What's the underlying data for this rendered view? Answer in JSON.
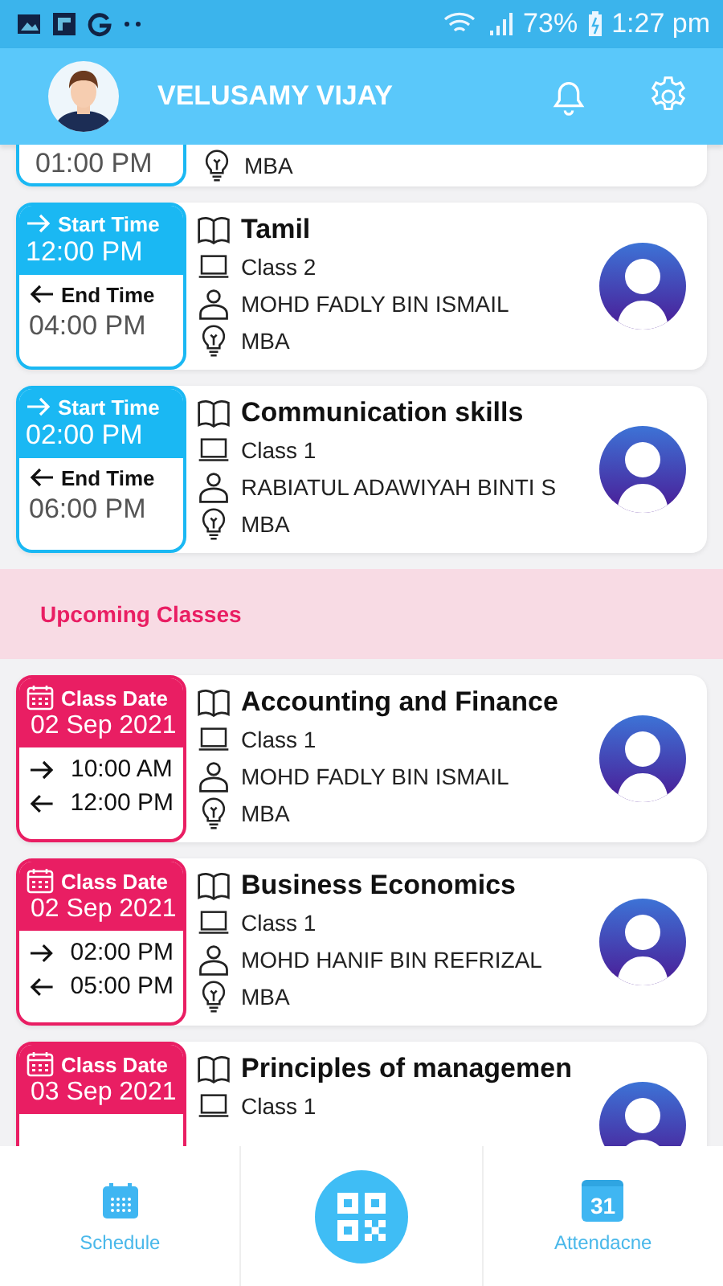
{
  "status_bar": {
    "battery": "73%",
    "time": "1:27 pm"
  },
  "header": {
    "name": "VELUSAMY VIJAY"
  },
  "today_classes": [
    {
      "kind": "partial",
      "end_time": "01:00 PM",
      "program": "MBA"
    },
    {
      "kind": "full",
      "start_label": "Start Time",
      "start_time": "12:00 PM",
      "end_label": "End Time",
      "end_time": "04:00 PM",
      "subject": "Tamil",
      "class": "Class 2",
      "teacher": "MOHD FADLY BIN ISMAIL",
      "program": "MBA"
    },
    {
      "kind": "full",
      "start_label": "Start Time",
      "start_time": "02:00 PM",
      "end_label": "End Time",
      "end_time": "06:00 PM",
      "subject": "Communication skills",
      "class": "Class 1",
      "teacher": "RABIATUL ADAWIYAH BINTI S",
      "program": "MBA"
    }
  ],
  "section_title": "Upcoming Classes",
  "upcoming_classes": [
    {
      "date_label": "Class Date",
      "date": "02 Sep 2021",
      "start_time": "10:00 AM",
      "end_time": "12:00 PM",
      "subject": "Accounting and Finance",
      "class": "Class 1",
      "teacher": "MOHD FADLY BIN ISMAIL",
      "program": "MBA"
    },
    {
      "date_label": "Class Date",
      "date": "02 Sep 2021",
      "start_time": "02:00 PM",
      "end_time": "05:00 PM",
      "subject": "Business Economics",
      "class": "Class 1",
      "teacher": "MOHD HANIF BIN REFRIZAL",
      "program": "MBA"
    },
    {
      "date_label": "Class Date",
      "date": "03 Sep 2021",
      "subject": "Principles of managemen",
      "class": "Class 1"
    }
  ],
  "nav": [
    {
      "kind": "schedule",
      "label": "Schedule"
    },
    {
      "kind": "qr"
    },
    {
      "kind": "calendar",
      "label": "Attendacne",
      "badge": "31"
    }
  ]
}
